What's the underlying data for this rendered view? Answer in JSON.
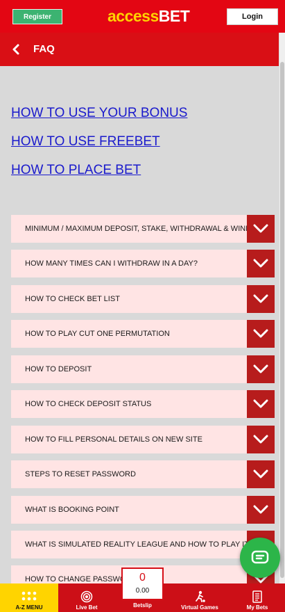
{
  "header": {
    "register_label": "Register",
    "logo_part1": "access",
    "logo_part2": "BET",
    "login_label": "Login"
  },
  "subheader": {
    "title": "FAQ"
  },
  "links": [
    "HOW TO USE YOUR BONUS",
    "HOW TO USE FREEBET",
    "HOW TO PLACE BET"
  ],
  "faq": [
    "MINIMUM / MAXIMUM DEPOSIT, STAKE, WITHDRAWAL & WINNING",
    "HOW MANY TIMES CAN I WITHDRAW IN A DAY?",
    "HOW TO CHECK BET LIST",
    "HOW TO PLAY CUT ONE PERMUTATION",
    "HOW TO DEPOSIT",
    "HOW TO CHECK DEPOSIT STATUS",
    "HOW TO FILL PERSONAL DETAILS ON NEW SITE",
    "STEPS TO RESET PASSWORD",
    "WHAT IS BOOKING POINT",
    "WHAT IS SIMULATED REALITY LEAGUE AND HOW TO PLAY IT",
    "HOW TO CHANGE PASSWORD"
  ],
  "bottom_nav": {
    "az_menu": "A-Z MENU",
    "live_bet": "Live Bet",
    "betslip": "Betslip",
    "betslip_count": "0",
    "betslip_amount": "0.00",
    "virtual_games": "Virtual Games",
    "my_bets": "My Bets"
  },
  "colors": {
    "brand_red": "#e30613",
    "faq_bg": "#ffe4e4",
    "toggle_red": "#b71c1c",
    "chat_green": "#2cb549",
    "active_yellow": "#ffd400"
  }
}
